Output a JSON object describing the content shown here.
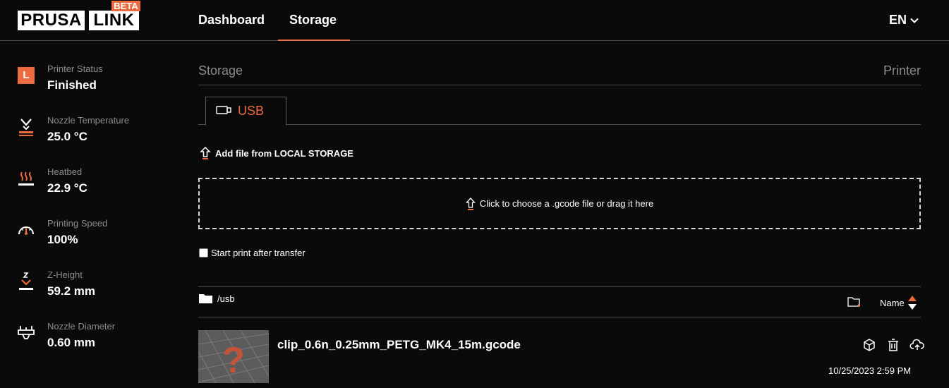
{
  "header": {
    "logo": {
      "prusa": "PRUSA",
      "link": "LINK",
      "beta": "BETA"
    },
    "nav": [
      {
        "label": "Dashboard"
      },
      {
        "label": "Storage"
      }
    ],
    "language": "EN"
  },
  "sidebar": [
    {
      "label": "Printer Status",
      "value": "Finished",
      "icon": "printer-status-icon",
      "badge": "L"
    },
    {
      "label": "Nozzle Temperature",
      "value": "25.0 °C",
      "icon": "nozzle-icon"
    },
    {
      "label": "Heatbed",
      "value": "22.9 °C",
      "icon": "heatbed-icon"
    },
    {
      "label": "Printing Speed",
      "value": "100%",
      "icon": "speedometer-icon"
    },
    {
      "label": "Z-Height",
      "value": "59.2 mm",
      "icon": "z-height-icon"
    },
    {
      "label": "Nozzle Diameter",
      "value": "0.60 mm",
      "icon": "nozzle-diameter-icon"
    }
  ],
  "main": {
    "breadcrumb": {
      "left": "Storage",
      "right": "Printer"
    },
    "storage_tab": {
      "label": "USB",
      "icon": "usb-drive-icon"
    },
    "add_file_label": "Add file from LOCAL STORAGE",
    "dropzone_label": "Click to choose a .gcode file or drag it here",
    "start_after_transfer": {
      "label": "Start print after transfer",
      "checked": false
    },
    "path": "/usb",
    "sort_label": "Name",
    "files": [
      {
        "name": "clip_0.6n_0.25mm_PETG_MK4_15m.gcode",
        "date": "10/25/2023 2:59 PM"
      }
    ]
  },
  "colors": {
    "accent": "#ed6b3e",
    "background": "#0a0a0a",
    "muted_text": "#8c8c8c"
  }
}
